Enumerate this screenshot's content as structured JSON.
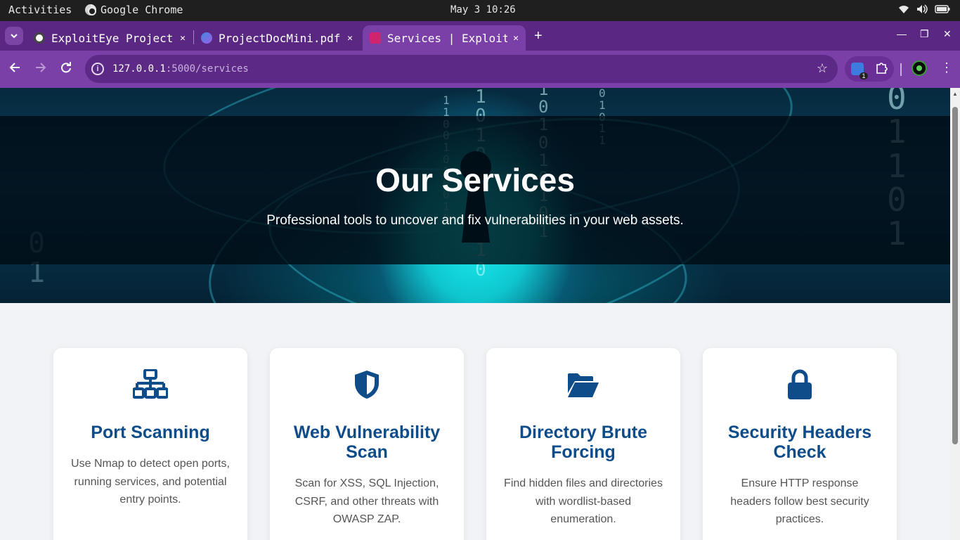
{
  "system_bar": {
    "activities": "Activities",
    "app_name": "Google Chrome",
    "clock": "May 3  10:26"
  },
  "tabs": [
    {
      "title": "ExploitEye Project",
      "favicon": "chatgpt-icon",
      "active": false
    },
    {
      "title": "ProjectDocMini.pdf",
      "favicon": "pdf-icon",
      "active": false
    },
    {
      "title": "Services | ExploitEye",
      "favicon": "lock-favicon",
      "active": true
    }
  ],
  "omnibox": {
    "url_host": "127.0.0.1",
    "url_rest": ":5000/services"
  },
  "extensions": {
    "badge_count": "1"
  },
  "hero": {
    "title": "Our Services",
    "subtitle": "Professional tools to uncover and fix vulnerabilities in your web assets."
  },
  "services": [
    {
      "icon": "network-icon",
      "title": "Port Scanning",
      "description": "Use Nmap to detect open ports, running services, and potential entry points."
    },
    {
      "icon": "shield-icon",
      "title": "Web Vulnerability Scan",
      "description": "Scan for XSS, SQL Injection, CSRF, and other threats with OWASP ZAP."
    },
    {
      "icon": "folder-open-icon",
      "title": "Directory Brute Forcing",
      "description": "Find hidden files and directories with wordlist-based enumeration."
    },
    {
      "icon": "lock-icon",
      "title": "Security Headers Check",
      "description": "Ensure HTTP response headers follow best security practices."
    }
  ],
  "colors": {
    "brand_purple": "#7b3fa8",
    "tab_strip": "#5a2883",
    "heading_blue": "#0e4c8a",
    "hero_cyan": "#19f0ef"
  }
}
